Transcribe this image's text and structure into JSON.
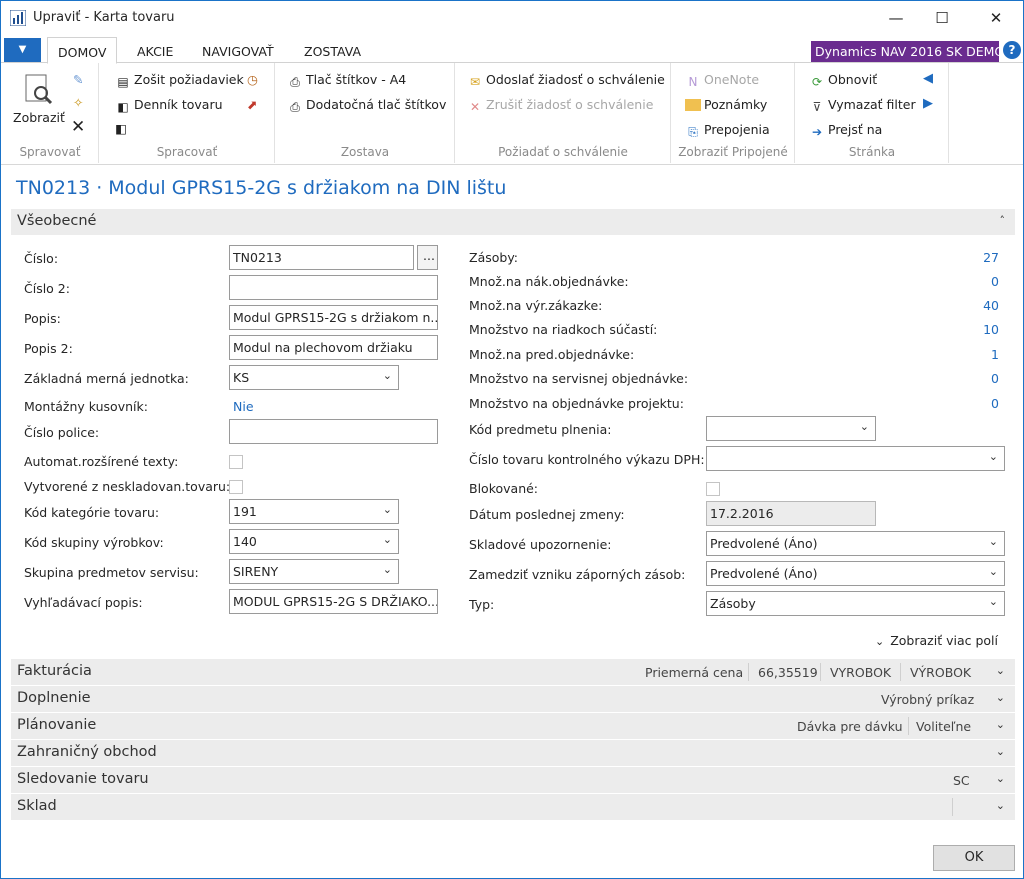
{
  "window": {
    "title": "Upraviť - Karta tovaru",
    "minimize": "—",
    "maximize": "☐",
    "close": "✕"
  },
  "tabs": {
    "file": "▼",
    "home": "DOMOV",
    "actions": "AKCIE",
    "navigate": "NAVIGOVAŤ",
    "report": "ZOSTAVA"
  },
  "demo_badge": "Dynamics NAV 2016 SK DEMO",
  "help": "?",
  "ribbon": {
    "manage": {
      "view": "Zobraziť",
      "label": "Spravovať"
    },
    "process": {
      "req": "Zošit požiadaviek",
      "journal": "Denník tovaru",
      "label": "Spracovať"
    },
    "report": {
      "print_a4": "Tlač štítkov - A4",
      "print_extra": "Dodatočná tlač štítkov",
      "label": "Zostava"
    },
    "approval": {
      "send": "Odoslať žiadosť o schválenie",
      "cancel": "Zrušiť žiadosť o schválenie",
      "label": "Požiadať o schválenie"
    },
    "attached": {
      "onenote": "OneNote",
      "notes": "Poznámky",
      "links": "Prepojenia",
      "label": "Zobraziť Pripojené"
    },
    "page": {
      "refresh": "Obnoviť",
      "clear": "Vymazať filter",
      "goto": "Prejsť na",
      "label": "Stránka"
    }
  },
  "page_title": "TN0213 · Modul GPRS15-2G s držiakom na DIN lištu",
  "general": {
    "title": "Všeobecné",
    "no_label": "Číslo:",
    "no": "TN0213",
    "assist": "...",
    "no2_label": "Číslo 2:",
    "no2": "",
    "desc_label": "Popis:",
    "desc": "Modul GPRS15-2G s držiakom n...",
    "desc2_label": "Popis 2:",
    "desc2": "Modul na plechovom držiaku",
    "uom_label": "Základná merná jednotka:",
    "uom": "KS",
    "bom_label": "Montážny kusovník:",
    "bom": "Nie",
    "shelf_label": "Číslo police:",
    "shelf": "",
    "autotext_label": "Automat.rozšírené texty:",
    "created_label": "Vytvorené z neskladovan.tovaru:",
    "cat_label": "Kód kategórie tovaru:",
    "cat": "191",
    "grp_label": "Kód skupiny výrobkov:",
    "grp": "140",
    "svc_label": "Skupina predmetov servisu:",
    "svc": "SIRENY",
    "search_label": "Vyhľadávací popis:",
    "search": "MODUL GPRS15-2G S DRŽIAKO...",
    "inv_label": "Zásoby:",
    "inv": "27",
    "po_label": "Množ.na nák.objednávke:",
    "po": "0",
    "prod_label": "Množ.na výr.zákazke:",
    "prod": "40",
    "comp_label": "Množstvo na riadkoch súčastí:",
    "comp": "10",
    "so_label": "Množ.na pred.objednávke:",
    "so": "1",
    "serv_label": "Množstvo na servisnej objednávke:",
    "serv": "0",
    "job_label": "Množstvo na objednávke projektu:",
    "job": "0",
    "subj_label": "Kód predmetu plnenia:",
    "subj": "",
    "vat_label": "Číslo tovaru kontrolného výkazu DPH:",
    "vat": "",
    "blocked_label": "Blokované:",
    "mod_label": "Dátum poslednej zmeny:",
    "mod": "17.2.2016",
    "stockout_label": "Skladové upozornenie:",
    "stockout": "Predvolené (Áno)",
    "neg_label": "Zamedziť vzniku záporných zásob:",
    "neg": "Predvolené (Áno)",
    "type_label": "Typ:",
    "type": "Zásoby",
    "more": "Zobraziť viac polí"
  },
  "sections": {
    "invoicing": {
      "title": "Fakturácia",
      "s1": "Priemerná cena",
      "s2": "66,35519",
      "s3": "VYROBOK",
      "s4": "VÝROBOK"
    },
    "replenish": {
      "title": "Doplnenie",
      "s1": "Výrobný príkaz"
    },
    "planning": {
      "title": "Plánovanie",
      "s1": "Dávka pre dávku",
      "s2": "Voliteľne"
    },
    "foreign": {
      "title": "Zahraničný obchod"
    },
    "tracking": {
      "title": "Sledovanie tovaru",
      "s1": "SC"
    },
    "warehouse": {
      "title": "Sklad"
    }
  },
  "ok": "OK",
  "colors": {
    "accent": "#1f6bbf",
    "demo": "#6a2c8f"
  }
}
